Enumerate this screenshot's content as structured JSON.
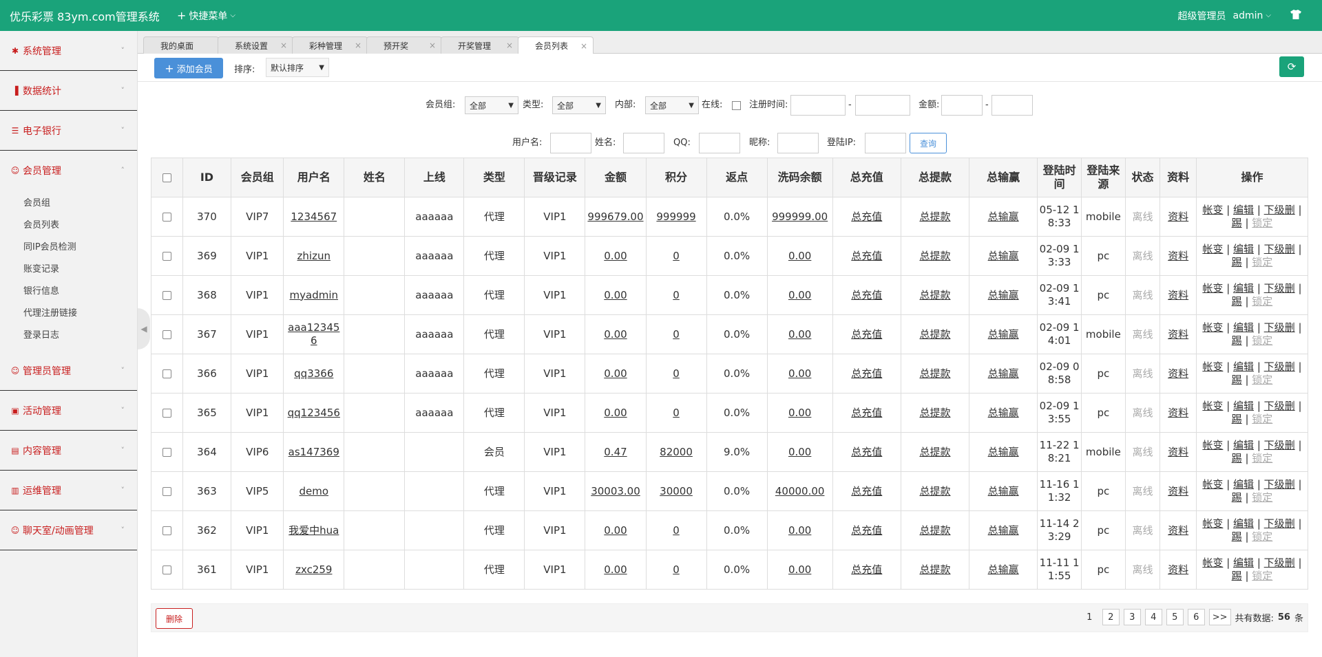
{
  "topbar": {
    "title": "优乐彩票 83ym.com管理系统",
    "quick_menu": "快捷菜单",
    "role": "超级管理员",
    "username": "admin"
  },
  "sidebar": {
    "groups": [
      {
        "label": "系统管理",
        "icon": "gear-icon"
      },
      {
        "label": "数据统计",
        "icon": "bar-chart-icon"
      },
      {
        "label": "电子银行",
        "icon": "list-icon"
      },
      {
        "label": "会员管理",
        "icon": "user-icon",
        "expanded": true,
        "items": [
          "会员组",
          "会员列表",
          "同IP会员检测",
          "账变记录",
          "银行信息",
          "代理注册链接",
          "登录日志"
        ]
      },
      {
        "label": "管理员管理",
        "icon": "user-icon"
      },
      {
        "label": "活动管理",
        "icon": "gift-icon"
      },
      {
        "label": "内容管理",
        "icon": "document-icon"
      },
      {
        "label": "运维管理",
        "icon": "book-icon"
      },
      {
        "label": "聊天室/动画管理",
        "icon": "user-icon"
      }
    ]
  },
  "tabs": [
    {
      "label": "我的桌面",
      "closable": false
    },
    {
      "label": "系统设置",
      "closable": true
    },
    {
      "label": "彩种管理",
      "closable": true
    },
    {
      "label": "预开奖",
      "closable": true
    },
    {
      "label": "开奖管理",
      "closable": true
    },
    {
      "label": "会员列表",
      "closable": true,
      "active": true
    }
  ],
  "toolbar": {
    "add_label": "添加会员",
    "sort_label": "排序:",
    "sort_value": "默认排序"
  },
  "filters": {
    "group_label": "会员组:",
    "group_value": "全部",
    "type_label": "类型:",
    "type_value": "全部",
    "internal_label": "内部:",
    "internal_value": "全部",
    "online_label": "在线:",
    "regtime_label": "注册时间:",
    "dash": "-",
    "amount_label": "金额:",
    "username_label": "用户名:",
    "realname_label": "姓名:",
    "qq_label": "QQ:",
    "nickname_label": "昵称:",
    "loginip_label": "登陆IP:",
    "query_label": "查询"
  },
  "table": {
    "headers": [
      "ID",
      "会员组",
      "用户名",
      "姓名",
      "上线",
      "类型",
      "晋级记录",
      "金额",
      "积分",
      "返点",
      "洗码余额",
      "总充值",
      "总提款",
      "总输赢",
      "登陆时间",
      "登陆来源",
      "状态",
      "资料",
      "操作"
    ],
    "rows": [
      {
        "id": "370",
        "group": "VIP7",
        "username": "1234567",
        "name": "",
        "upline": "aaaaaa",
        "type": "代理",
        "promo": "VIP1",
        "amount": "999679.00",
        "points": "999999",
        "rebate": "0.0%",
        "wash": "999999.00",
        "recharge": "总充值",
        "withdraw": "总提款",
        "winloss": "总输赢",
        "login_time": "05-12 18:33",
        "source": "mobile",
        "status": "离线",
        "profile": "资料"
      },
      {
        "id": "369",
        "group": "VIP1",
        "username": "zhizun",
        "name": "",
        "upline": "aaaaaa",
        "type": "代理",
        "promo": "VIP1",
        "amount": "0.00",
        "points": "0",
        "rebate": "0.0%",
        "wash": "0.00",
        "recharge": "总充值",
        "withdraw": "总提款",
        "winloss": "总输赢",
        "login_time": "02-09 13:33",
        "source": "pc",
        "status": "离线",
        "profile": "资料"
      },
      {
        "id": "368",
        "group": "VIP1",
        "username": "myadmin",
        "name": "",
        "upline": "aaaaaa",
        "type": "代理",
        "promo": "VIP1",
        "amount": "0.00",
        "points": "0",
        "rebate": "0.0%",
        "wash": "0.00",
        "recharge": "总充值",
        "withdraw": "总提款",
        "winloss": "总输赢",
        "login_time": "02-09 13:41",
        "source": "pc",
        "status": "离线",
        "profile": "资料"
      },
      {
        "id": "367",
        "group": "VIP1",
        "username": "aaa123456",
        "name": "",
        "upline": "aaaaaa",
        "type": "代理",
        "promo": "VIP1",
        "amount": "0.00",
        "points": "0",
        "rebate": "0.0%",
        "wash": "0.00",
        "recharge": "总充值",
        "withdraw": "总提款",
        "winloss": "总输赢",
        "login_time": "02-09 14:01",
        "source": "mobile",
        "status": "离线",
        "profile": "资料"
      },
      {
        "id": "366",
        "group": "VIP1",
        "username": "qq3366",
        "name": "",
        "upline": "aaaaaa",
        "type": "代理",
        "promo": "VIP1",
        "amount": "0.00",
        "points": "0",
        "rebate": "0.0%",
        "wash": "0.00",
        "recharge": "总充值",
        "withdraw": "总提款",
        "winloss": "总输赢",
        "login_time": "02-09 08:58",
        "source": "pc",
        "status": "离线",
        "profile": "资料"
      },
      {
        "id": "365",
        "group": "VIP1",
        "username": "qq123456",
        "name": "",
        "upline": "aaaaaa",
        "type": "代理",
        "promo": "VIP1",
        "amount": "0.00",
        "points": "0",
        "rebate": "0.0%",
        "wash": "0.00",
        "recharge": "总充值",
        "withdraw": "总提款",
        "winloss": "总输赢",
        "login_time": "02-09 13:55",
        "source": "pc",
        "status": "离线",
        "profile": "资料"
      },
      {
        "id": "364",
        "group": "VIP6",
        "username": "as147369",
        "name": "",
        "upline": "",
        "type": "会员",
        "promo": "VIP1",
        "amount": "0.47",
        "points": "82000",
        "rebate": "9.0%",
        "wash": "0.00",
        "recharge": "总充值",
        "withdraw": "总提款",
        "winloss": "总输赢",
        "login_time": "11-22 18:21",
        "source": "mobile",
        "status": "离线",
        "profile": "资料"
      },
      {
        "id": "363",
        "group": "VIP5",
        "username": "demo",
        "name": "",
        "upline": "",
        "type": "代理",
        "promo": "VIP1",
        "amount": "30003.00",
        "points": "30000",
        "rebate": "0.0%",
        "wash": "40000.00",
        "recharge": "总充值",
        "withdraw": "总提款",
        "winloss": "总输赢",
        "login_time": "11-16 11:32",
        "source": "pc",
        "status": "离线",
        "profile": "资料"
      },
      {
        "id": "362",
        "group": "VIP1",
        "username": "我爱中hua",
        "name": "",
        "upline": "",
        "type": "代理",
        "promo": "VIP1",
        "amount": "0.00",
        "points": "0",
        "rebate": "0.0%",
        "wash": "0.00",
        "recharge": "总充值",
        "withdraw": "总提款",
        "winloss": "总输赢",
        "login_time": "11-14 23:29",
        "source": "pc",
        "status": "离线",
        "profile": "资料"
      },
      {
        "id": "361",
        "group": "VIP1",
        "username": "zxc259",
        "name": "",
        "upline": "",
        "type": "代理",
        "promo": "VIP1",
        "amount": "0.00",
        "points": "0",
        "rebate": "0.0%",
        "wash": "0.00",
        "recharge": "总充值",
        "withdraw": "总提款",
        "winloss": "总输赢",
        "login_time": "11-11 11:55",
        "source": "pc",
        "status": "离线",
        "profile": "资料"
      }
    ],
    "ops": {
      "change": "帐变",
      "sep": "|",
      "edit": "编辑",
      "sub": "下级",
      "delete": "删",
      "kick": "踢",
      "lock": "锁定"
    }
  },
  "footer": {
    "delete_label": "删除",
    "pages": [
      "1",
      "2",
      "3",
      "4",
      "5",
      "6"
    ],
    "current_page": "1",
    "next_label": ">>",
    "total_prefix": "共有数据:",
    "total_count": "56",
    "total_suffix": "条"
  },
  "colors": {
    "brand": "#1aa37a",
    "accent_blue": "#4a90d9",
    "accent_red": "#c81e1e"
  }
}
